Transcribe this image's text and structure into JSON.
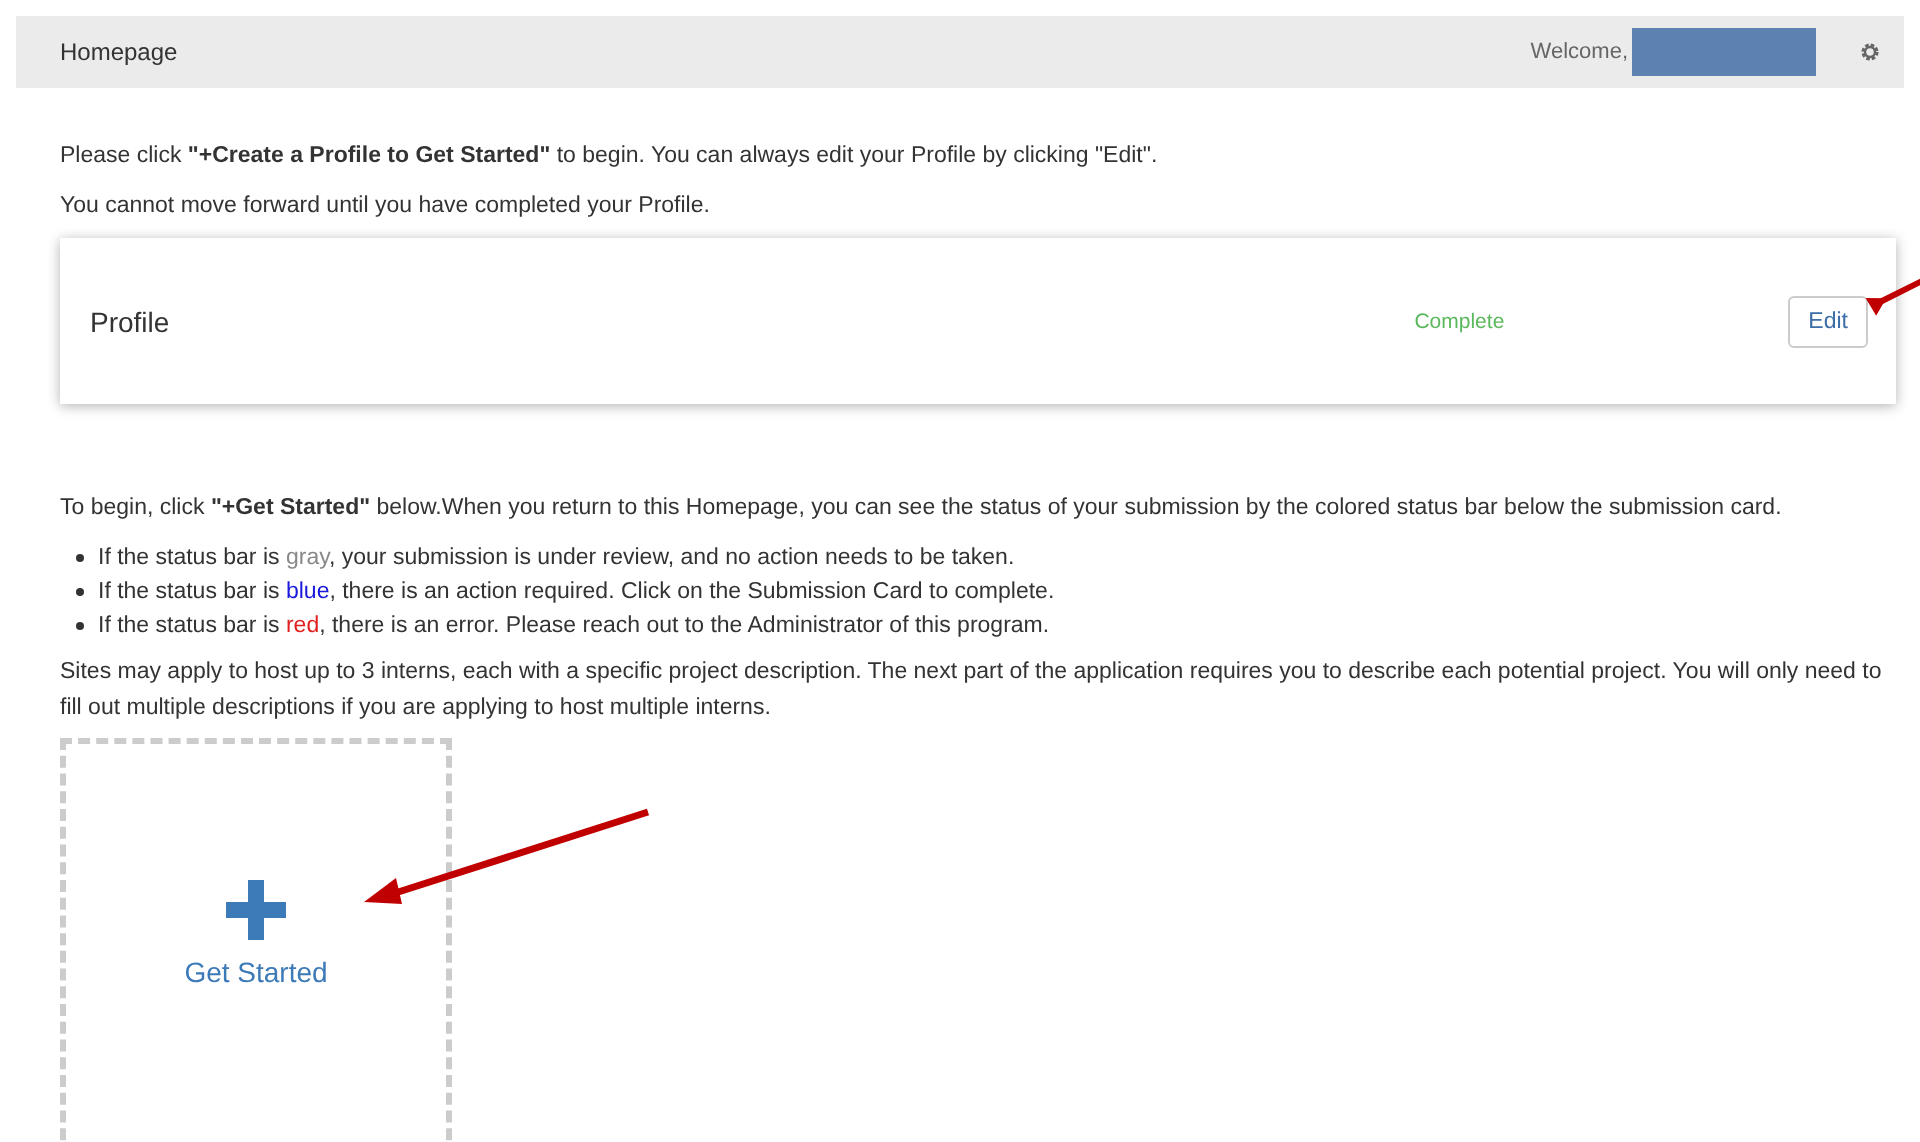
{
  "header": {
    "title": "Homepage",
    "welcome": "Welcome,",
    "user_redacted": true
  },
  "intro": [
    "Please click **\"+Create a Profile to Get Started\"** to begin. You can always edit your Profile by clicking \"Edit\".",
    "You cannot move forward until you have completed your Profile."
  ],
  "profile_card": {
    "title": "Profile",
    "status": "Complete",
    "button": "Edit"
  },
  "instructions": "To begin, click **\"+Get Started\"** below.When you return to this Homepage, you can see the status of your submission by the colored status bar below the submission card.",
  "bullets": [
    {
      "before": "If the status bar is ",
      "colored": "gray",
      "color": "#888888",
      "after": ", your submission is under review, and no action needs to be taken."
    },
    {
      "before": "If the status bar is ",
      "colored": "blue",
      "color": "#1a1adb",
      "after": ", there is an action required. Click on the Submission Card to complete."
    },
    {
      "before": "If the status bar is ",
      "colored": "red",
      "color": "#e02020",
      "after": ", there is an error. Please reach out to the Administrator of this program."
    }
  ],
  "note": "Sites may apply to host up to 3 interns, each with a specific project description. The next part of the application requires you to describe each potential project. You will only need to fill out multiple descriptions if you are applying to host multiple interns.",
  "get_started": {
    "label": "Get Started"
  }
}
